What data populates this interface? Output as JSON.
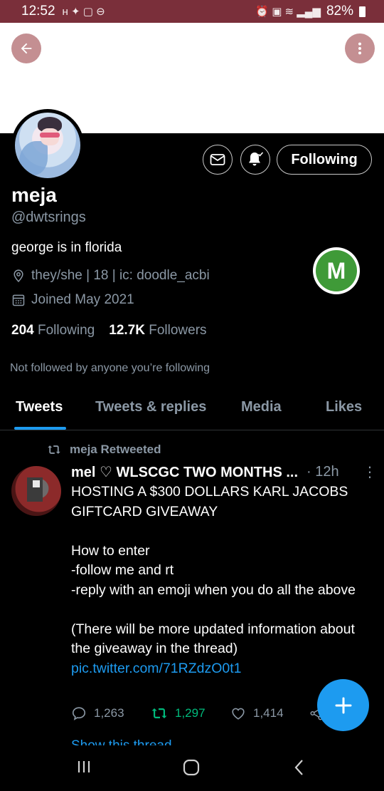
{
  "status_bar": {
    "time": "12:52",
    "battery": "82%"
  },
  "profile": {
    "name": "meja",
    "handle": "@dwtsrings",
    "bio": "george is in florida",
    "location": "they/she | 18 | ic: doodle_acbi",
    "joined": "Joined May 2021",
    "following_count": "204",
    "following_label": "Following",
    "followers_count": "12.7K",
    "followers_label": "Followers",
    "not_followed_text": "Not followed by anyone you’re following",
    "follow_button_label": "Following"
  },
  "tabs": [
    {
      "label": "Tweets",
      "active": true
    },
    {
      "label": "Tweets & replies",
      "active": false
    },
    {
      "label": "Media",
      "active": false
    },
    {
      "label": "Likes",
      "active": false
    }
  ],
  "tweet": {
    "retweet_context": "meja Retweeted",
    "author": "mel ♡ WLSCGC TWO MONTHS ...",
    "time": "· 12h",
    "body": "HOSTING A $300 DOLLARS KARL JACOBS GIFTCARD GIVEAWAY\n\nHow to enter\n-follow me and rt\n-reply with an emoji when you do all the above\n\n(There will be more updated information about the giveaway in the thread)",
    "link": "pic.twitter.com/71RZdzO0t1",
    "replies": "1,263",
    "retweets": "1,297",
    "likes": "1,414",
    "show_thread": "Show this thread"
  },
  "colors": {
    "accent": "#1d9bf0",
    "retweet": "#00ba7c",
    "status_bar": "#7a2f3a",
    "muted": "#8b98a5"
  },
  "icons": [
    "back-arrow-icon",
    "more-vertical-icon",
    "mail-icon",
    "bell-icon",
    "location-icon",
    "calendar-icon",
    "retweet-icon",
    "reply-icon",
    "like-icon",
    "share-icon",
    "compose-plus-icon"
  ]
}
